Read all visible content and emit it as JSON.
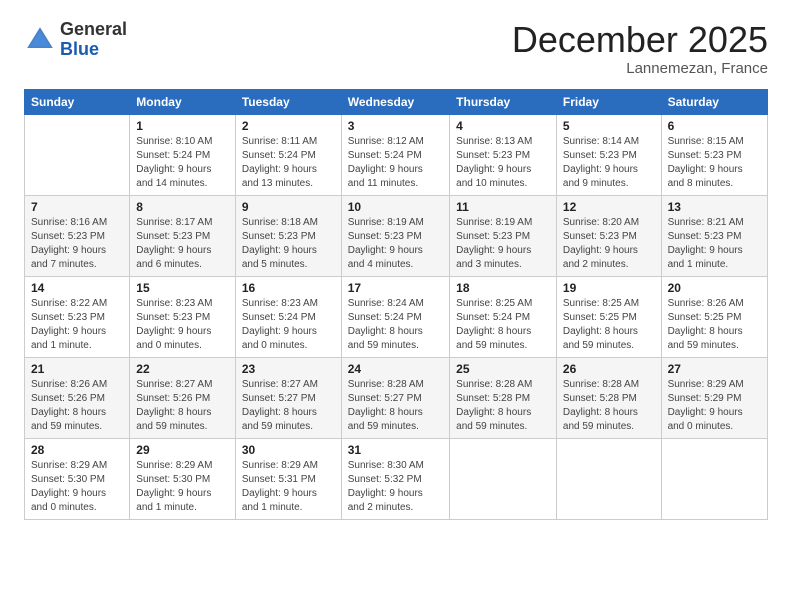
{
  "header": {
    "logo_general": "General",
    "logo_blue": "Blue",
    "month_title": "December 2025",
    "location": "Lannemezan, France"
  },
  "days_of_week": [
    "Sunday",
    "Monday",
    "Tuesday",
    "Wednesday",
    "Thursday",
    "Friday",
    "Saturday"
  ],
  "weeks": [
    [
      {
        "num": "",
        "info": ""
      },
      {
        "num": "1",
        "info": "Sunrise: 8:10 AM\nSunset: 5:24 PM\nDaylight: 9 hours\nand 14 minutes."
      },
      {
        "num": "2",
        "info": "Sunrise: 8:11 AM\nSunset: 5:24 PM\nDaylight: 9 hours\nand 13 minutes."
      },
      {
        "num": "3",
        "info": "Sunrise: 8:12 AM\nSunset: 5:24 PM\nDaylight: 9 hours\nand 11 minutes."
      },
      {
        "num": "4",
        "info": "Sunrise: 8:13 AM\nSunset: 5:23 PM\nDaylight: 9 hours\nand 10 minutes."
      },
      {
        "num": "5",
        "info": "Sunrise: 8:14 AM\nSunset: 5:23 PM\nDaylight: 9 hours\nand 9 minutes."
      },
      {
        "num": "6",
        "info": "Sunrise: 8:15 AM\nSunset: 5:23 PM\nDaylight: 9 hours\nand 8 minutes."
      }
    ],
    [
      {
        "num": "7",
        "info": "Sunrise: 8:16 AM\nSunset: 5:23 PM\nDaylight: 9 hours\nand 7 minutes."
      },
      {
        "num": "8",
        "info": "Sunrise: 8:17 AM\nSunset: 5:23 PM\nDaylight: 9 hours\nand 6 minutes."
      },
      {
        "num": "9",
        "info": "Sunrise: 8:18 AM\nSunset: 5:23 PM\nDaylight: 9 hours\nand 5 minutes."
      },
      {
        "num": "10",
        "info": "Sunrise: 8:19 AM\nSunset: 5:23 PM\nDaylight: 9 hours\nand 4 minutes."
      },
      {
        "num": "11",
        "info": "Sunrise: 8:19 AM\nSunset: 5:23 PM\nDaylight: 9 hours\nand 3 minutes."
      },
      {
        "num": "12",
        "info": "Sunrise: 8:20 AM\nSunset: 5:23 PM\nDaylight: 9 hours\nand 2 minutes."
      },
      {
        "num": "13",
        "info": "Sunrise: 8:21 AM\nSunset: 5:23 PM\nDaylight: 9 hours\nand 1 minute."
      }
    ],
    [
      {
        "num": "14",
        "info": "Sunrise: 8:22 AM\nSunset: 5:23 PM\nDaylight: 9 hours\nand 1 minute."
      },
      {
        "num": "15",
        "info": "Sunrise: 8:23 AM\nSunset: 5:23 PM\nDaylight: 9 hours\nand 0 minutes."
      },
      {
        "num": "16",
        "info": "Sunrise: 8:23 AM\nSunset: 5:24 PM\nDaylight: 9 hours\nand 0 minutes."
      },
      {
        "num": "17",
        "info": "Sunrise: 8:24 AM\nSunset: 5:24 PM\nDaylight: 8 hours\nand 59 minutes."
      },
      {
        "num": "18",
        "info": "Sunrise: 8:25 AM\nSunset: 5:24 PM\nDaylight: 8 hours\nand 59 minutes."
      },
      {
        "num": "19",
        "info": "Sunrise: 8:25 AM\nSunset: 5:25 PM\nDaylight: 8 hours\nand 59 minutes."
      },
      {
        "num": "20",
        "info": "Sunrise: 8:26 AM\nSunset: 5:25 PM\nDaylight: 8 hours\nand 59 minutes."
      }
    ],
    [
      {
        "num": "21",
        "info": "Sunrise: 8:26 AM\nSunset: 5:26 PM\nDaylight: 8 hours\nand 59 minutes."
      },
      {
        "num": "22",
        "info": "Sunrise: 8:27 AM\nSunset: 5:26 PM\nDaylight: 8 hours\nand 59 minutes."
      },
      {
        "num": "23",
        "info": "Sunrise: 8:27 AM\nSunset: 5:27 PM\nDaylight: 8 hours\nand 59 minutes."
      },
      {
        "num": "24",
        "info": "Sunrise: 8:28 AM\nSunset: 5:27 PM\nDaylight: 8 hours\nand 59 minutes."
      },
      {
        "num": "25",
        "info": "Sunrise: 8:28 AM\nSunset: 5:28 PM\nDaylight: 8 hours\nand 59 minutes."
      },
      {
        "num": "26",
        "info": "Sunrise: 8:28 AM\nSunset: 5:28 PM\nDaylight: 8 hours\nand 59 minutes."
      },
      {
        "num": "27",
        "info": "Sunrise: 8:29 AM\nSunset: 5:29 PM\nDaylight: 9 hours\nand 0 minutes."
      }
    ],
    [
      {
        "num": "28",
        "info": "Sunrise: 8:29 AM\nSunset: 5:30 PM\nDaylight: 9 hours\nand 0 minutes."
      },
      {
        "num": "29",
        "info": "Sunrise: 8:29 AM\nSunset: 5:30 PM\nDaylight: 9 hours\nand 1 minute."
      },
      {
        "num": "30",
        "info": "Sunrise: 8:29 AM\nSunset: 5:31 PM\nDaylight: 9 hours\nand 1 minute."
      },
      {
        "num": "31",
        "info": "Sunrise: 8:30 AM\nSunset: 5:32 PM\nDaylight: 9 hours\nand 2 minutes."
      },
      {
        "num": "",
        "info": ""
      },
      {
        "num": "",
        "info": ""
      },
      {
        "num": "",
        "info": ""
      }
    ]
  ]
}
